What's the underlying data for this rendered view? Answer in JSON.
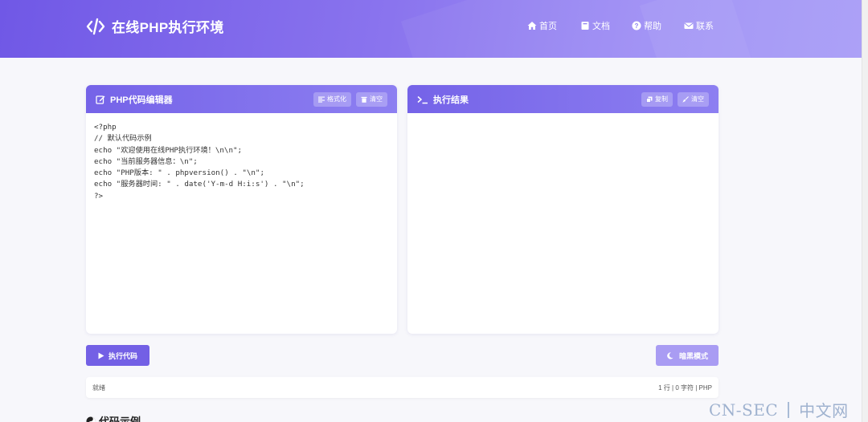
{
  "header": {
    "title": "在线PHP执行环境",
    "nav": [
      {
        "label": "首页",
        "icon": "home-icon"
      },
      {
        "label": "文档",
        "icon": "book-icon"
      },
      {
        "label": "帮助",
        "icon": "question-circle-icon"
      },
      {
        "label": "联系",
        "icon": "envelope-icon"
      }
    ]
  },
  "editor": {
    "title": "PHP代码编辑器",
    "format_label": "格式化",
    "clear_label": "清空",
    "code": "<?php\n// 默认代码示例\necho \"欢迎使用在线PHP执行环境！\\n\\n\";\necho \"当前服务器信息：\\n\";\necho \"PHP版本: \" . phpversion() . \"\\n\";\necho \"服务器时间: \" . date('Y-m-d H:i:s') . \"\\n\";\n?>"
  },
  "output": {
    "title": "执行结果",
    "copy_label": "复制",
    "clear_label": "清空",
    "content": ""
  },
  "actions": {
    "run_label": "执行代码",
    "dark_label": "暗黑模式"
  },
  "status": {
    "left": "就绪",
    "right": "1 行 | 0 字符 | PHP"
  },
  "examples": {
    "title": "代码示例"
  },
  "watermark": {
    "left": "CN-SEC",
    "right": "中文网"
  },
  "colors": {
    "accent": "#7360e5",
    "header_start": "#7058e6",
    "header_end": "#a79cf7",
    "dark_button": "#a99cf3"
  }
}
